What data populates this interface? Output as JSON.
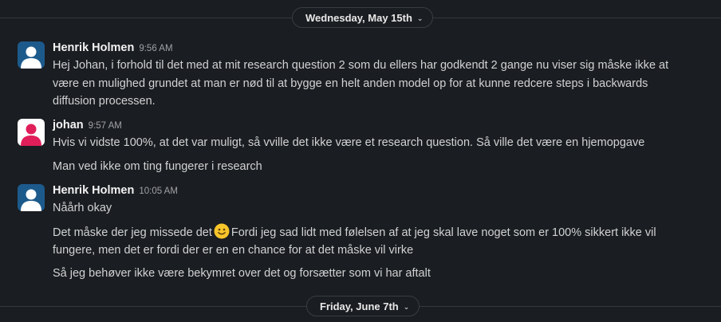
{
  "dates": {
    "first": "Wednesday, May 15th",
    "second": "Friday, June 7th"
  },
  "colors": {
    "background": "#1a1d21",
    "henrik_avatar": "#1d5a8c",
    "johan_avatar": "#e01e5a"
  },
  "messages": [
    {
      "author": "Henrik Holmen",
      "time": "9:56 AM",
      "avatar_icon": "person-icon",
      "lines": [
        "Hej Johan, i forhold til det med at mit research question 2 som du ellers har godkendt 2 gange nu viser sig måske ikke at",
        "være en mulighed grundet at man er nød til at bygge en helt anden model op for at kunne redcere steps i backwards",
        "diffusion processen."
      ]
    },
    {
      "author": "johan",
      "time": "9:57 AM",
      "avatar_icon": "person-icon",
      "lines": [
        "Hvis vi vidste 100%, at det var muligt, så vville det ikke være et research question. Så ville det være en hjemopgave",
        "Man ved ikke om ting fungerer i research"
      ]
    },
    {
      "author": "Henrik Holmen",
      "time": "10:05 AM",
      "avatar_icon": "person-icon",
      "lines": [
        "Nåårh okay",
        "Det måske der jeg missede det",
        "Fordi jeg sad lidt med følelsen af at jeg skal lave noget som er 100% sikkert ikke vil",
        "fungere, men det er fordi der er en en chance for at det måske vil virke",
        "Så jeg behøver ikke være bekymret over det og forsætter som vi har aftalt"
      ],
      "emoji_icon": "slightly-smiling-face-icon"
    }
  ]
}
